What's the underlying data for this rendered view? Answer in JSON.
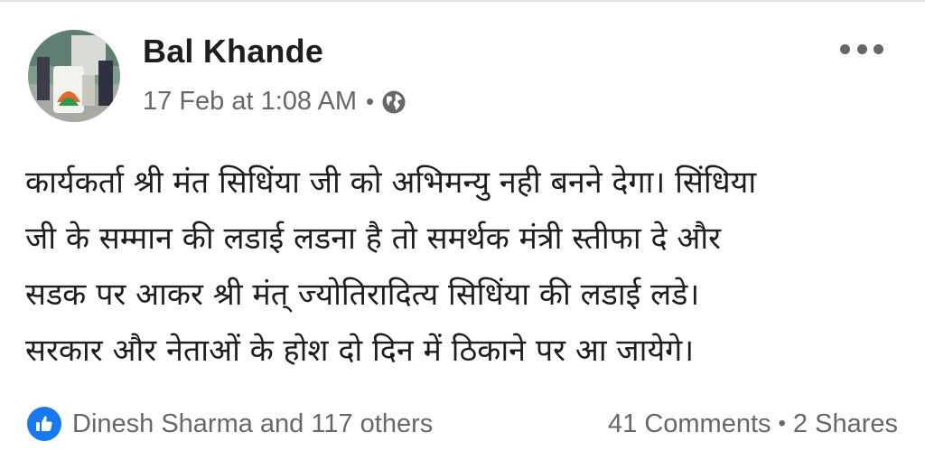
{
  "post": {
    "author": "Bal Khande",
    "timestamp": "17 Feb at 1:08 AM",
    "separator": "•",
    "privacy_icon": "globe-icon",
    "more_icon": "more-options-icon",
    "text": "कार्यकर्ता श्री मंत सिधिंया जी को अभिमन्यु नही बनने देगा। सिंधिया\nजी के सम्मान की लडाई लडना है तो समर्थक मंत्री स्तीफा दे और\nसडक पर आकर श्री मंत् ज्योतिरादित्य सिधिंया की लडाई लडे।\nसरकार और नेताओं के होश दो दिन में ठिकाने पर आ जायेगे।"
  },
  "footer": {
    "like_icon": "like-reaction-icon",
    "reactions": "Dinesh Sharma and 117 others",
    "comments": "41 Comments",
    "separator": "•",
    "shares": "2 Shares"
  },
  "colors": {
    "text_primary": "#1c1e21",
    "text_secondary": "#65676b",
    "like_blue": "#1877f2"
  }
}
